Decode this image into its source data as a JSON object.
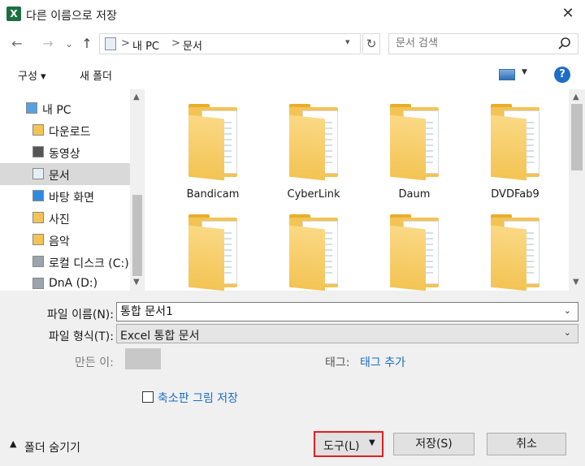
{
  "window": {
    "app_icon_letter": "X",
    "title": "다른 이름으로 저장",
    "close_glyph": "✕"
  },
  "navigation": {
    "back_glyph": "←",
    "forward_glyph": "→",
    "recent_glyph": "⌄",
    "up_glyph": "↑",
    "breadcrumbs": [
      "내 PC",
      "문서"
    ],
    "crumb_separator": ">",
    "refresh_glyph": "↻",
    "search_placeholder": "문서 검색"
  },
  "toolbar": {
    "organize_label": "구성 ▾",
    "new_folder_label": "새 폴더",
    "help_label": "?"
  },
  "tree": {
    "items": [
      {
        "label": "내 PC",
        "icon": "computer-icon"
      },
      {
        "label": "다운로드",
        "icon": "download-folder-icon"
      },
      {
        "label": "동영상",
        "icon": "video-folder-icon"
      },
      {
        "label": "문서",
        "icon": "document-folder-icon",
        "selected": true
      },
      {
        "label": "바탕 화면",
        "icon": "desktop-folder-icon"
      },
      {
        "label": "사진",
        "icon": "pictures-folder-icon"
      },
      {
        "label": "음악",
        "icon": "music-folder-icon"
      },
      {
        "label": "로컬 디스크 (C:)",
        "icon": "drive-icon"
      },
      {
        "label": "DnA (D:)",
        "icon": "drive-icon"
      }
    ]
  },
  "files": [
    {
      "name": "Bandicam"
    },
    {
      "name": "CyberLink"
    },
    {
      "name": "Daum"
    },
    {
      "name": "DVDFab9"
    },
    {
      "name": ""
    },
    {
      "name": ""
    },
    {
      "name": ""
    },
    {
      "name": ""
    }
  ],
  "form": {
    "filename_label": "파일 이름(N):",
    "filename_value": "통합 문서1",
    "filetype_label": "파일 형식(T):",
    "filetype_value": "Excel 통합 문서",
    "author_label": "만든 이:",
    "tags_label": "태그:",
    "tags_link": "태그 추가",
    "thumbnail_label": "축소판 그림 저장",
    "hide_folders_label": "폴더 숨기기",
    "tools_label": "도구(L)",
    "save_label": "저장(S)",
    "cancel_label": "취소"
  },
  "colors": {
    "accent": "#1a6dc2",
    "highlight_border": "#e21f1f",
    "folder": "#f3c454"
  }
}
